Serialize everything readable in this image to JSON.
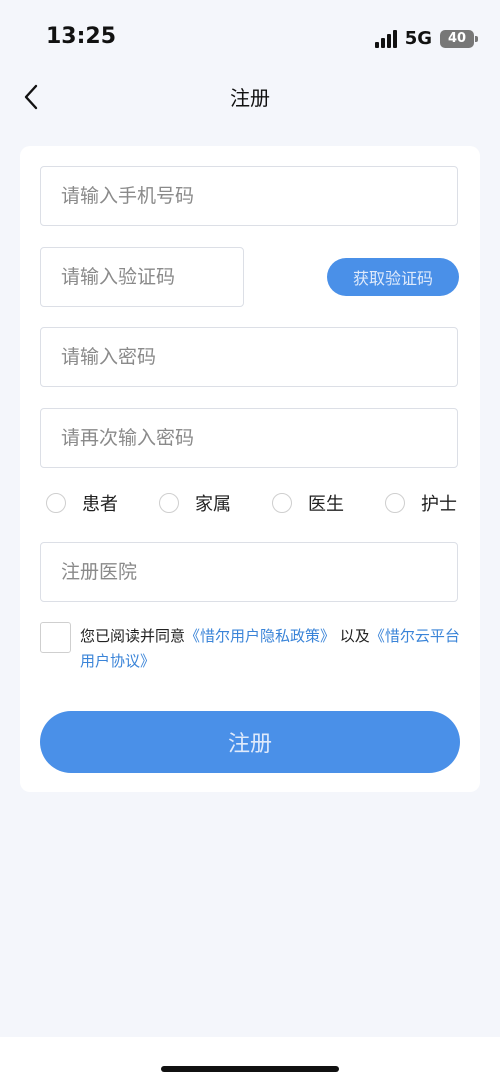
{
  "status_bar": {
    "time": "13:25",
    "network": "5G",
    "battery": "40"
  },
  "nav": {
    "back_icon": "chevron-left-icon",
    "title": "注册"
  },
  "form": {
    "phone_placeholder": "请输入手机号码",
    "code_placeholder": "请输入验证码",
    "get_code_label": "获取验证码",
    "password_placeholder": "请输入密码",
    "confirm_password_placeholder": "请再次输入密码",
    "roles": [
      "患者",
      "家属",
      "医生",
      "护士"
    ],
    "hospital_placeholder": "注册医院",
    "agreement": {
      "prefix": "您已阅读并同意",
      "privacy_link": "《惜尔用户隐私政策》",
      "middle": " 以及",
      "terms_link": "《惜尔云平台用户协议》"
    },
    "submit_label": "注册"
  },
  "colors": {
    "accent": "#4a90e8",
    "link": "#3a84d8",
    "page_bg": "#f4f6fb"
  }
}
